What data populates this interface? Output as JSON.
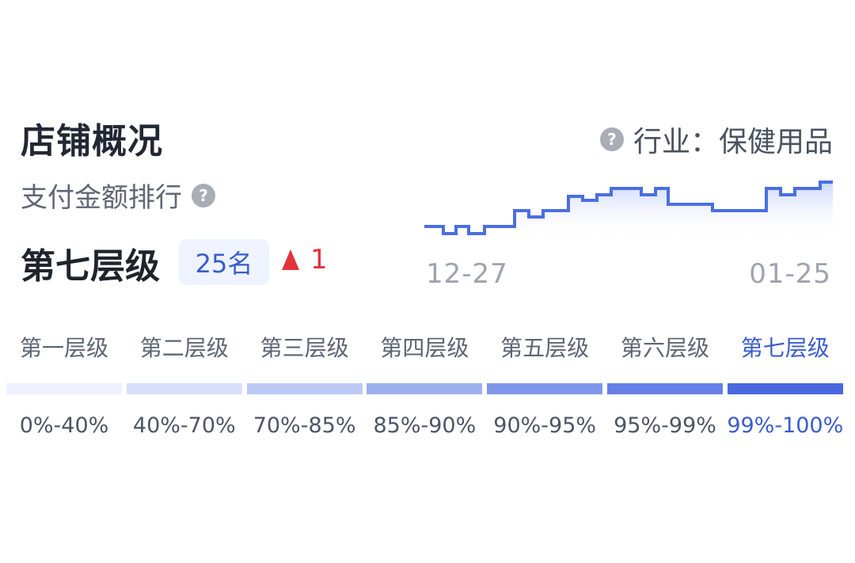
{
  "header": {
    "title": "店铺概况",
    "industry": "行业：保健用品",
    "help_icon": "question-circle-icon"
  },
  "ranking": {
    "label": "支付金额排行",
    "level": "第七层级",
    "rank": "25名",
    "change": "1",
    "change_direction": "up",
    "change_icon": "up-triangle-icon"
  },
  "trend": {
    "start_date": "12-27",
    "end_date": "01-25",
    "line_color": "#4a6fe0"
  },
  "tiers": [
    {
      "label": "第一层级",
      "range": "0%-40%",
      "color": "#eef1fd"
    },
    {
      "label": "第二层级",
      "range": "40%-70%",
      "color": "#d9e0fb"
    },
    {
      "label": "第三层级",
      "range": "70%-85%",
      "color": "#bcc9f6"
    },
    {
      "label": "第四层级",
      "range": "85%-90%",
      "color": "#9db0f0"
    },
    {
      "label": "第五层级",
      "range": "90%-95%",
      "color": "#7f97ea"
    },
    {
      "label": "第六层级",
      "range": "95%-99%",
      "color": "#6580e6"
    },
    {
      "label": "第七层级",
      "range": "99%-100%",
      "color": "#4a68e0",
      "active": true
    }
  ]
}
